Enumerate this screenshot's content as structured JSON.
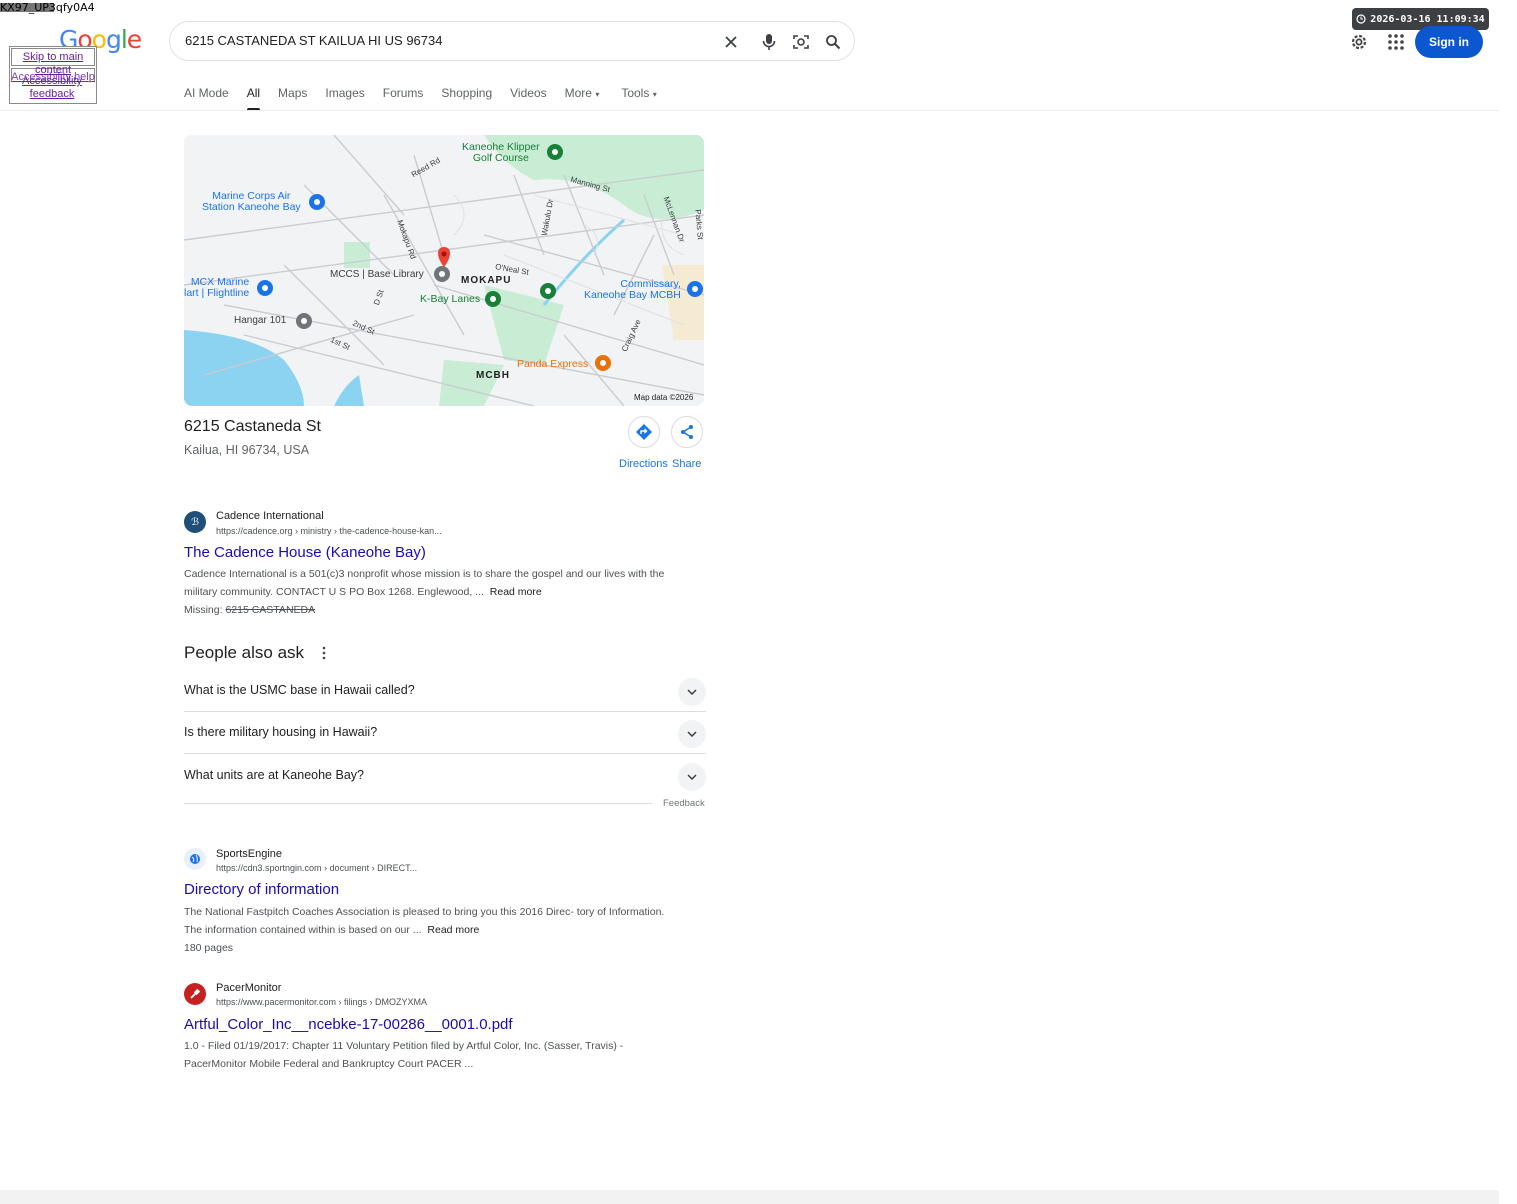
{
  "debug_text": "KX97_UP3qfy0A4",
  "logo_text": {
    "G": "G",
    "o1": "o",
    "o2": "o",
    "g": "g",
    "l": "l",
    "e": "e"
  },
  "skip_links": {
    "link1": "Skip to main content",
    "link2": "Accessibility help",
    "link3": "Accessibility feedback"
  },
  "search": {
    "query": "6215 CASTANEDA ST KAILUA HI US 96734"
  },
  "header": {
    "timestamp": "2026-03-16 11:09:34",
    "signin_label": "Sign in"
  },
  "tabs": [
    {
      "label": "AI Mode"
    },
    {
      "label": "All"
    },
    {
      "label": "Maps"
    },
    {
      "label": "Images"
    },
    {
      "label": "Forums"
    },
    {
      "label": "Shopping"
    },
    {
      "label": "Videos"
    },
    {
      "label": "More"
    },
    {
      "label": "Tools"
    }
  ],
  "map": {
    "labels": {
      "golf": "Kaneohe Klipper\nGolf Course",
      "reed": "Reed Rd",
      "manning": "Manning St",
      "mclennan": "McLennan Dr",
      "parks": "Parks St",
      "marine": "Marine Corps Air\nStation Kaneohe Bay",
      "mokapu_rd": "Mokapu Rd",
      "wakulu": "Wakulu Dr",
      "library": "MCCS | Base Library",
      "mokapu": "MOKAPU",
      "oneal": "O'Neal St",
      "mcx": "MCX Marine\nlart | Flightline",
      "dst": "D St",
      "kbay": "K-Bay Lanes",
      "commissary": "Commissary,\nKaneohe Bay MCBH",
      "hangar": "Hangar 101",
      "second": "2nd St",
      "first": "1st St",
      "craig": "Craig Ave",
      "panda": "Panda Express",
      "mcbh": "MCBH",
      "attribution": "Map data ©2026"
    }
  },
  "place": {
    "title": "6215 Castaneda St",
    "subtitle": "Kailua, HI 96734, USA",
    "directions_label": "Directions",
    "share_label": "Share"
  },
  "results": [
    {
      "site": "Cadence International",
      "url": "https://cadence.org › ministry › the-cadence-house-kan...",
      "title": "The Cadence House (Kaneohe Bay)",
      "snippet_1": "Cadence International is a 501(c)3 nonprofit whose mission is to share the gospel and our lives with the",
      "snippet_2": "military community. CONTACT U S PO Box 1268. Englewood, ...",
      "read_more": "Read more",
      "missing_label": "Missing:",
      "missing_terms": "6215 CASTANEDA"
    },
    {
      "site": "SportsEngine",
      "url": "https://cdn3.sportngin.com › document › DIRECT...",
      "title": "Directory of information",
      "snippet_1": "The National Fastpitch Coaches Association is pleased to bring you this 2016 Direc- tory of Information.",
      "snippet_2": "The information contained within is based on our ...",
      "read_more": "Read more",
      "pages": "180 pages"
    },
    {
      "site": "PacerMonitor",
      "url": "https://www.pacermonitor.com › filings › DMOZYXMA",
      "title": "Artful_Color_Inc__ncebke-17-00286__0001.0.pdf",
      "snippet_1": "1.0 - Filed 01/19/2017: Chapter 11 Voluntary Petition filed by Artful Color, Inc. (Sasser, Travis) -",
      "snippet_2": "PacerMonitor Mobile Federal and Bankruptcy Court PACER ..."
    }
  ],
  "paa": {
    "title": "People also ask",
    "questions": [
      "What is the USMC base in Hawaii called?",
      "Is there military housing in Hawaii?",
      "What units are at Kaneohe Bay?"
    ],
    "feedback": "Feedback"
  },
  "colors": {
    "link": "#1a0dab",
    "accent": "#0b57d0",
    "map_water": "#8bd3f0",
    "map_green": "#c8ecd4"
  }
}
